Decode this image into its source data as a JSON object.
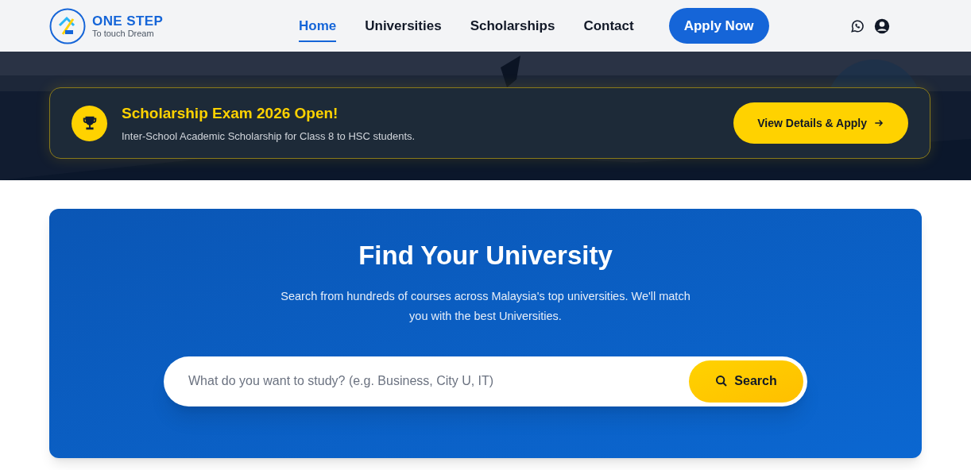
{
  "header": {
    "logo": {
      "title": "ONE STEP",
      "tagline": "To touch Dream"
    },
    "nav": [
      {
        "label": "Home",
        "selected": true
      },
      {
        "label": "Universities",
        "selected": false
      },
      {
        "label": "Scholarships",
        "selected": false
      },
      {
        "label": "Contact",
        "selected": false
      }
    ],
    "cta": "Apply Now"
  },
  "hero": {
    "kind": "picture",
    "announcement": {
      "title": "Scholarship Exam 2026 Open!",
      "text": "Inter-School Academic Scholarship for Class 8 to HSC students.",
      "button": "View Details & Apply"
    }
  },
  "finder": {
    "title": "Find Your University",
    "subtitle": "Search from hundreds of courses across Malaysia's top universities. We'll match you with the best Universities.",
    "search": {
      "placeholder": "What do you want to study? (e.g. Business, City U, IT)",
      "button": "Search"
    }
  }
}
